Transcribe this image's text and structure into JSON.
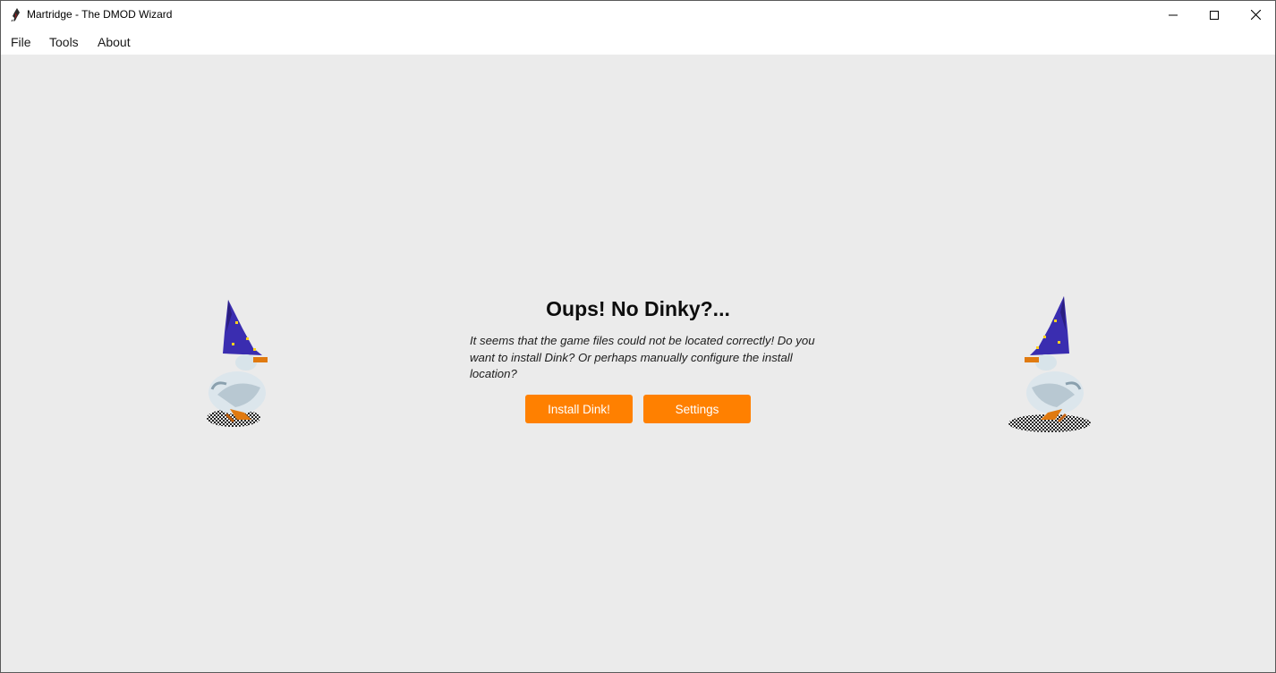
{
  "window": {
    "title": "Martridge - The DMOD Wizard",
    "app_icon": "feather-icon",
    "controls": [
      "minimize-icon",
      "maximize-icon",
      "close-icon"
    ]
  },
  "menu": {
    "file": "File",
    "tools": "Tools",
    "about": "About"
  },
  "dialog": {
    "heading": "Oups! No Dinky?...",
    "message": "It seems that the game files could not be located correctly! Do you want to install Dink? Or perhaps manually configure the install location?",
    "install_label": "Install Dink!",
    "settings_label": "Settings"
  },
  "colors": {
    "accent": "#ff8000",
    "background": "#ebebeb",
    "titlebar": "#ffffff"
  },
  "images": [
    "wizard-duck-left",
    "wizard-duck-right"
  ]
}
